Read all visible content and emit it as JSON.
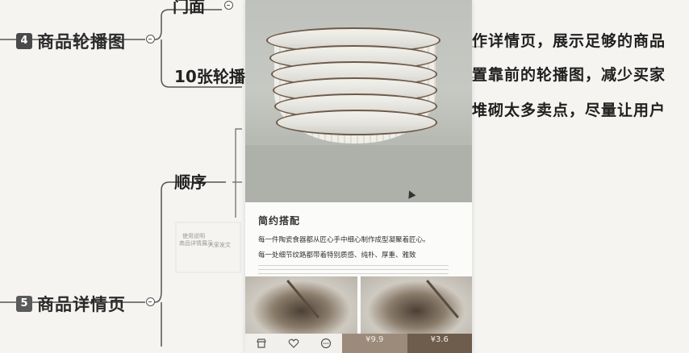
{
  "mindmap": {
    "top_fragment": "门面",
    "node4": {
      "badge": "4",
      "label": "商品轮播图"
    },
    "child_count": "10张轮播",
    "order": "顺序",
    "node5": {
      "badge": "5",
      "label": "商品详情页"
    },
    "right_lines": [
      "作详情页，展示足够的商品",
      "置靠前的轮播图，减少买家",
      "堆砌太多卖点，尽量让用户"
    ]
  },
  "thumbnail_fragments": {
    "text_a": "商品详情展示",
    "text_b": "大家发文",
    "text_c": "使用说明"
  },
  "phone": {
    "description": {
      "title": "简约搭配",
      "line1": "每一件陶瓷食器都从匠心手中细心制作成型凝聚着匠心。",
      "line2": "每一处细节纹路都带着特别质感、纯朴、厚重、雅致"
    },
    "bottom_bar": {
      "icons": [
        "shop-icon",
        "heart-icon",
        "chat-icon"
      ],
      "price_left": "¥9.9",
      "price_right": "¥3.6"
    }
  },
  "colors": {
    "brand_brown": "#6e5c4c",
    "brand_light": "#9c8b7b",
    "mindmap_line": "#555555"
  }
}
